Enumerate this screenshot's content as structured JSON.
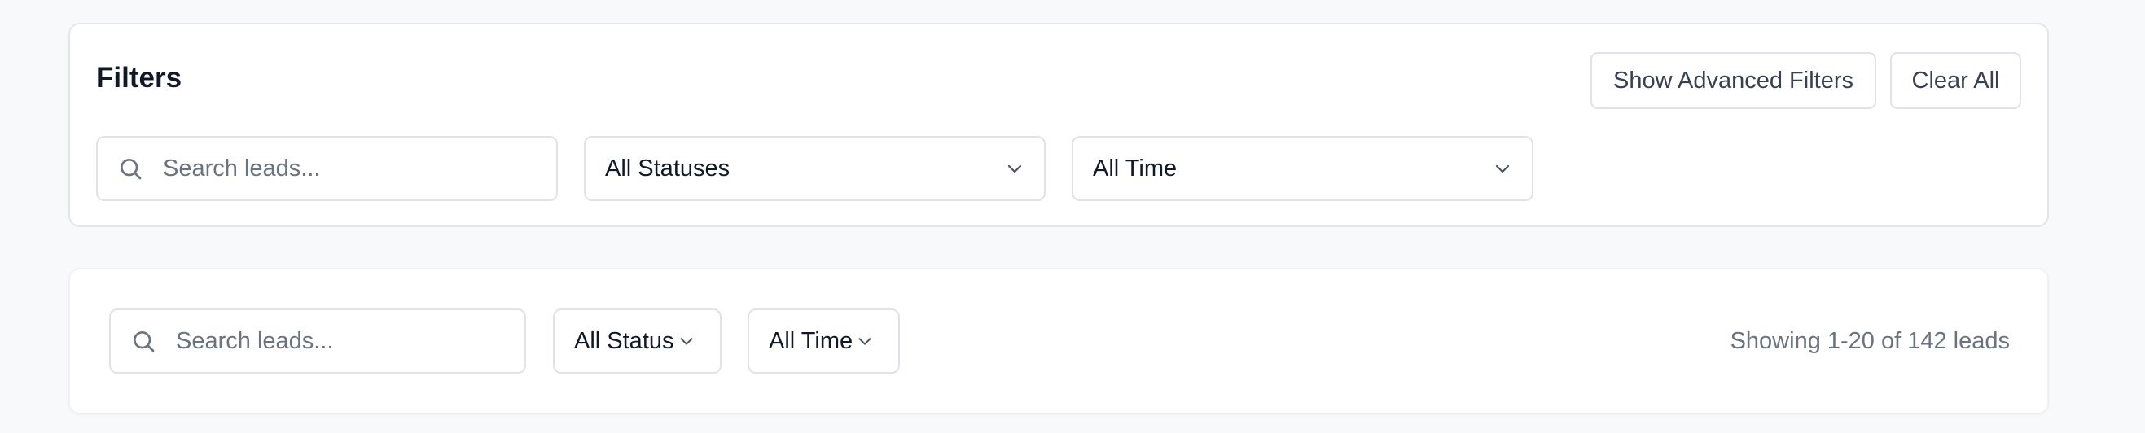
{
  "filters": {
    "title": "Filters",
    "show_advanced_label": "Show Advanced Filters",
    "clear_all_label": "Clear All",
    "search": {
      "value": "",
      "placeholder": "Search leads..."
    },
    "status_select": {
      "value": "All Statuses"
    },
    "time_select": {
      "value": "All Time"
    }
  },
  "toolbar": {
    "search": {
      "value": "",
      "placeholder": "Search leads..."
    },
    "status_select": {
      "value": "All Status"
    },
    "time_select": {
      "value": "All Time"
    },
    "showing_text": "Showing 1-20 of 142 leads"
  },
  "icons": {
    "search": "search-icon",
    "chevron": "chevron-down-icon"
  },
  "colors": {
    "background": "#f8f9fb",
    "card": "#ffffff",
    "border": "#dfe2e7",
    "text_primary": "#111827",
    "text_secondary": "#374151",
    "text_muted": "#6b7280"
  }
}
